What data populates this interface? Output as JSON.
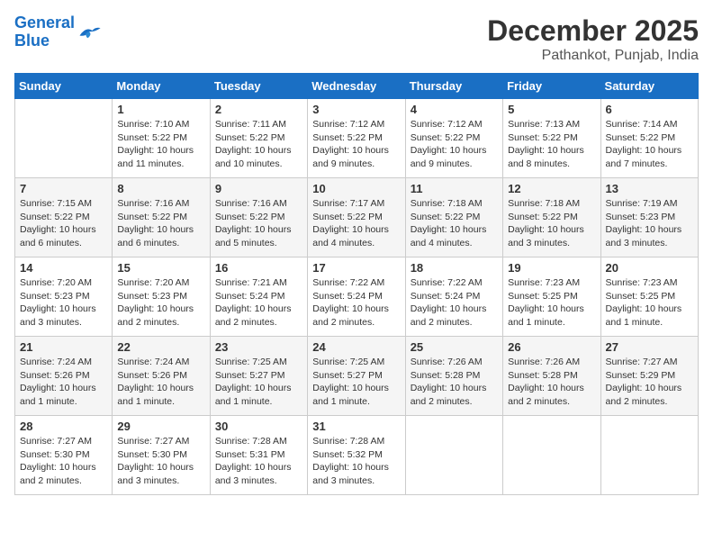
{
  "header": {
    "logo_line1": "General",
    "logo_line2": "Blue",
    "title": "December 2025",
    "subtitle": "Pathankot, Punjab, India"
  },
  "calendar": {
    "days_of_week": [
      "Sunday",
      "Monday",
      "Tuesday",
      "Wednesday",
      "Thursday",
      "Friday",
      "Saturday"
    ],
    "weeks": [
      [
        {
          "day": "",
          "info": ""
        },
        {
          "day": "1",
          "info": "Sunrise: 7:10 AM\nSunset: 5:22 PM\nDaylight: 10 hours\nand 11 minutes."
        },
        {
          "day": "2",
          "info": "Sunrise: 7:11 AM\nSunset: 5:22 PM\nDaylight: 10 hours\nand 10 minutes."
        },
        {
          "day": "3",
          "info": "Sunrise: 7:12 AM\nSunset: 5:22 PM\nDaylight: 10 hours\nand 9 minutes."
        },
        {
          "day": "4",
          "info": "Sunrise: 7:12 AM\nSunset: 5:22 PM\nDaylight: 10 hours\nand 9 minutes."
        },
        {
          "day": "5",
          "info": "Sunrise: 7:13 AM\nSunset: 5:22 PM\nDaylight: 10 hours\nand 8 minutes."
        },
        {
          "day": "6",
          "info": "Sunrise: 7:14 AM\nSunset: 5:22 PM\nDaylight: 10 hours\nand 7 minutes."
        }
      ],
      [
        {
          "day": "7",
          "info": "Sunrise: 7:15 AM\nSunset: 5:22 PM\nDaylight: 10 hours\nand 6 minutes."
        },
        {
          "day": "8",
          "info": "Sunrise: 7:16 AM\nSunset: 5:22 PM\nDaylight: 10 hours\nand 6 minutes."
        },
        {
          "day": "9",
          "info": "Sunrise: 7:16 AM\nSunset: 5:22 PM\nDaylight: 10 hours\nand 5 minutes."
        },
        {
          "day": "10",
          "info": "Sunrise: 7:17 AM\nSunset: 5:22 PM\nDaylight: 10 hours\nand 4 minutes."
        },
        {
          "day": "11",
          "info": "Sunrise: 7:18 AM\nSunset: 5:22 PM\nDaylight: 10 hours\nand 4 minutes."
        },
        {
          "day": "12",
          "info": "Sunrise: 7:18 AM\nSunset: 5:22 PM\nDaylight: 10 hours\nand 3 minutes."
        },
        {
          "day": "13",
          "info": "Sunrise: 7:19 AM\nSunset: 5:23 PM\nDaylight: 10 hours\nand 3 minutes."
        }
      ],
      [
        {
          "day": "14",
          "info": "Sunrise: 7:20 AM\nSunset: 5:23 PM\nDaylight: 10 hours\nand 3 minutes."
        },
        {
          "day": "15",
          "info": "Sunrise: 7:20 AM\nSunset: 5:23 PM\nDaylight: 10 hours\nand 2 minutes."
        },
        {
          "day": "16",
          "info": "Sunrise: 7:21 AM\nSunset: 5:24 PM\nDaylight: 10 hours\nand 2 minutes."
        },
        {
          "day": "17",
          "info": "Sunrise: 7:22 AM\nSunset: 5:24 PM\nDaylight: 10 hours\nand 2 minutes."
        },
        {
          "day": "18",
          "info": "Sunrise: 7:22 AM\nSunset: 5:24 PM\nDaylight: 10 hours\nand 2 minutes."
        },
        {
          "day": "19",
          "info": "Sunrise: 7:23 AM\nSunset: 5:25 PM\nDaylight: 10 hours\nand 1 minute."
        },
        {
          "day": "20",
          "info": "Sunrise: 7:23 AM\nSunset: 5:25 PM\nDaylight: 10 hours\nand 1 minute."
        }
      ],
      [
        {
          "day": "21",
          "info": "Sunrise: 7:24 AM\nSunset: 5:26 PM\nDaylight: 10 hours\nand 1 minute."
        },
        {
          "day": "22",
          "info": "Sunrise: 7:24 AM\nSunset: 5:26 PM\nDaylight: 10 hours\nand 1 minute."
        },
        {
          "day": "23",
          "info": "Sunrise: 7:25 AM\nSunset: 5:27 PM\nDaylight: 10 hours\nand 1 minute."
        },
        {
          "day": "24",
          "info": "Sunrise: 7:25 AM\nSunset: 5:27 PM\nDaylight: 10 hours\nand 1 minute."
        },
        {
          "day": "25",
          "info": "Sunrise: 7:26 AM\nSunset: 5:28 PM\nDaylight: 10 hours\nand 2 minutes."
        },
        {
          "day": "26",
          "info": "Sunrise: 7:26 AM\nSunset: 5:28 PM\nDaylight: 10 hours\nand 2 minutes."
        },
        {
          "day": "27",
          "info": "Sunrise: 7:27 AM\nSunset: 5:29 PM\nDaylight: 10 hours\nand 2 minutes."
        }
      ],
      [
        {
          "day": "28",
          "info": "Sunrise: 7:27 AM\nSunset: 5:30 PM\nDaylight: 10 hours\nand 2 minutes."
        },
        {
          "day": "29",
          "info": "Sunrise: 7:27 AM\nSunset: 5:30 PM\nDaylight: 10 hours\nand 3 minutes."
        },
        {
          "day": "30",
          "info": "Sunrise: 7:28 AM\nSunset: 5:31 PM\nDaylight: 10 hours\nand 3 minutes."
        },
        {
          "day": "31",
          "info": "Sunrise: 7:28 AM\nSunset: 5:32 PM\nDaylight: 10 hours\nand 3 minutes."
        },
        {
          "day": "",
          "info": ""
        },
        {
          "day": "",
          "info": ""
        },
        {
          "day": "",
          "info": ""
        }
      ]
    ]
  }
}
